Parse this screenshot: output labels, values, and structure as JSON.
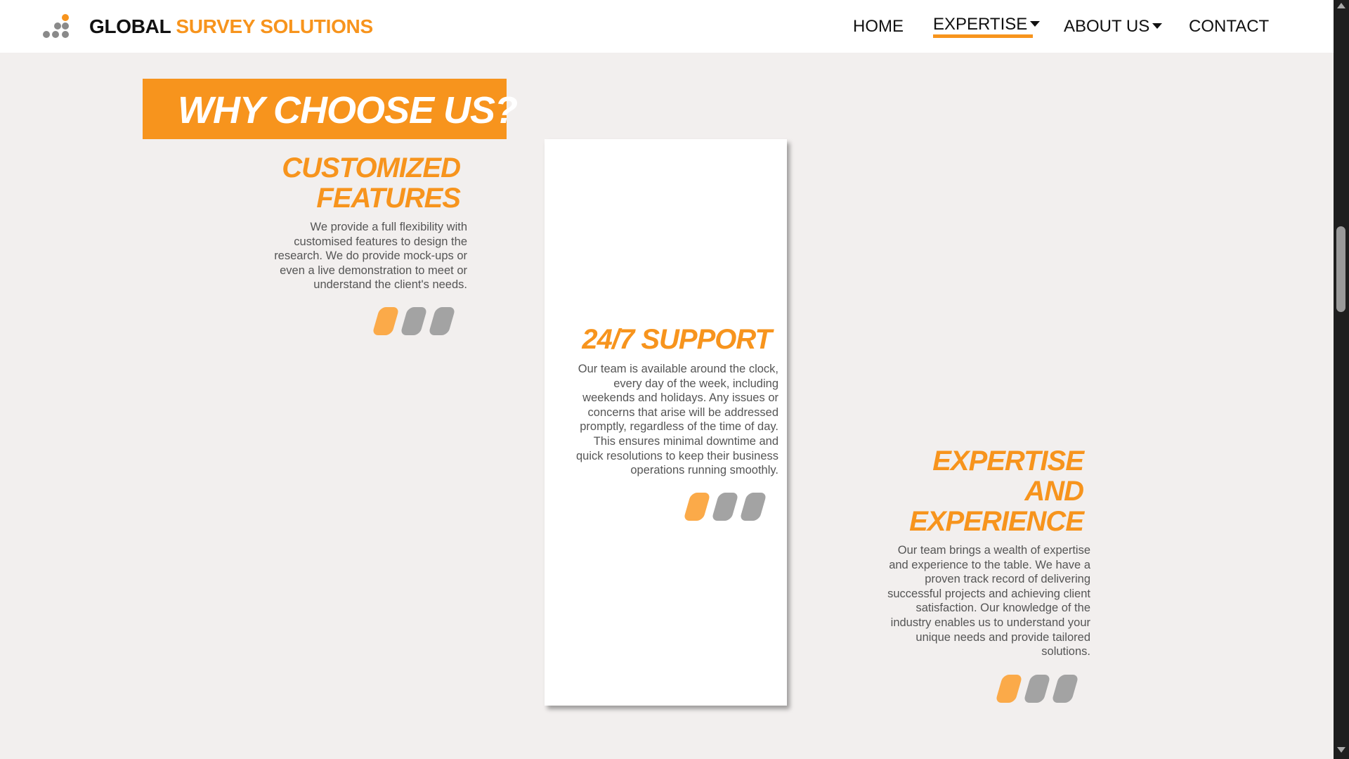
{
  "brand": {
    "part1": "GLOBAL",
    "part2": "SURVEY SOLUTIONS"
  },
  "nav": {
    "home": "HOME",
    "expertise": "EXPERTISE",
    "about": "ABOUT US",
    "contact": "CONTACT",
    "active": "EXPERTISE"
  },
  "colors": {
    "accent": "#f7941d",
    "accent_light": "#fbaa49",
    "gray": "#a3a3a3",
    "text": "#555555"
  },
  "section": {
    "title": "WHY CHOOSE US?"
  },
  "features": [
    {
      "title_lines": [
        "CUSTOMIZED",
        "FEATURES"
      ],
      "desc_lines": [
        "We provide a full flexibility with",
        "customised features to design the",
        "research. We do provide mock-ups or",
        "even a live demonstration to meet or",
        "understand the client's needs."
      ]
    },
    {
      "title_lines": [
        "24/7 SUPPORT"
      ],
      "desc_lines": [
        "Our team is available around the clock,",
        "every day of the week, including",
        "weekends and holidays. Any issues or",
        "concerns that arise will be addressed",
        "promptly, regardless of the time of day.",
        "This ensures minimal downtime and",
        "quick resolutions to keep their business",
        "operations running smoothly."
      ]
    },
    {
      "title_lines": [
        "EXPERTISE",
        "AND",
        "EXPERIENCE"
      ],
      "desc_lines": [
        "Our team brings a wealth of expertise",
        "and experience to the table. We have a",
        "proven track record of delivering",
        "successful projects and achieving client",
        "satisfaction. Our knowledge of the",
        "industry enables us to understand your",
        "unique needs and provide tailored",
        "solutions."
      ]
    }
  ]
}
